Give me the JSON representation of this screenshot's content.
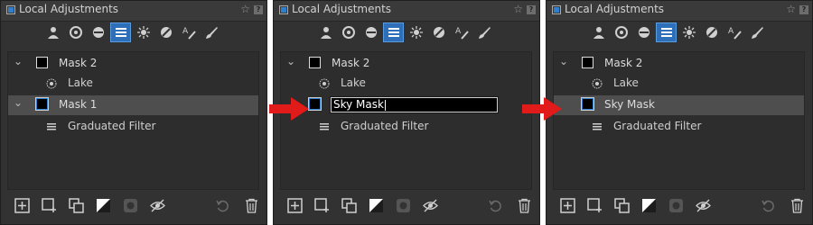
{
  "panel": {
    "title": "Local Adjustments",
    "star_icon": "star-icon",
    "help_label": "?",
    "tools": [
      {
        "icon": "person-brush-icon",
        "active": false
      },
      {
        "icon": "gradient-mask-icon",
        "active": false
      },
      {
        "icon": "radial-mask-icon",
        "active": false
      },
      {
        "icon": "layers-list-icon",
        "active": true
      },
      {
        "icon": "magic-wand-icon",
        "active": false
      },
      {
        "icon": "eraser-icon",
        "active": false
      },
      {
        "icon": "text-brush-icon",
        "active": false
      },
      {
        "icon": "brush-icon",
        "active": false
      }
    ]
  },
  "steps": [
    {
      "rows": [
        {
          "label": "Mask 2",
          "sub": "Lake"
        },
        {
          "label": "Mask 1",
          "sub": "Graduated Filter",
          "selected": true
        }
      ]
    },
    {
      "rows": [
        {
          "label": "Mask 2",
          "sub": "Lake"
        },
        {
          "edit_value": "Sky Mask",
          "sub": "Graduated Filter",
          "selected": true
        }
      ]
    },
    {
      "rows": [
        {
          "label": "Mask 2",
          "sub": "Lake"
        },
        {
          "label": "Sky Mask",
          "sub": "Graduated Filter",
          "selected": true
        }
      ]
    }
  ],
  "colors": {
    "accent": "#2d6fb8",
    "arrow": "#e11a1a",
    "panel_bg": "#323232",
    "selected_row": "#4e4e4e"
  }
}
